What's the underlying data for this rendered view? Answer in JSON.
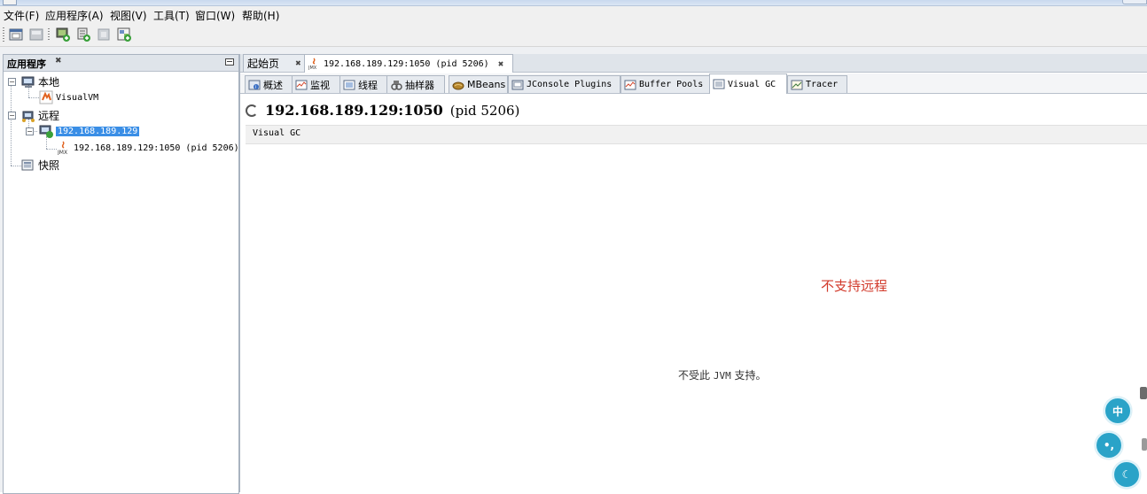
{
  "menubar": {
    "items": [
      "文件(F)",
      "应用程序(A)",
      "视图(V)",
      "工具(T)",
      "窗口(W)",
      "帮助(H)"
    ]
  },
  "toolbar": {
    "icons": [
      "open-application-icon",
      "save-snapshot-icon",
      "add-remote-host-icon",
      "add-jmx-connection-icon",
      "add-core-dump-icon",
      "add-snapshot-icon"
    ]
  },
  "left_panel": {
    "title": "应用程序",
    "tree": {
      "local": "本地",
      "visualvm": "VisualVM",
      "remote": "远程",
      "host": "192.168.189.129",
      "jmx": "192.168.189.129:1050  (pid 5206)",
      "snapshots": "快照"
    }
  },
  "doc_tabs": {
    "start": "起始页",
    "active": "192.168.189.129:1050  (pid 5206)"
  },
  "sub_tabs": {
    "items": [
      "概述",
      "监视",
      "线程",
      "抽样器",
      "MBeans",
      "JConsole Plugins",
      "Buffer Pools",
      "Visual GC",
      "Tracer"
    ],
    "active": "Visual GC"
  },
  "content": {
    "ip": "192.168.189.129:1050",
    "pid": "(pid 5206)",
    "subheader": "Visual GC",
    "red_note": "不支持远程",
    "gray_note_a": "不受此",
    "gray_note_jvm": "JVM",
    "gray_note_b": "支持。"
  },
  "floating": {
    "btn1": "中",
    "btn2": "•,",
    "btn3": "☾"
  },
  "colors": {
    "selection": "#3a8ee6",
    "note_red": "#d23a2b",
    "fab": "#2aa3c8"
  }
}
